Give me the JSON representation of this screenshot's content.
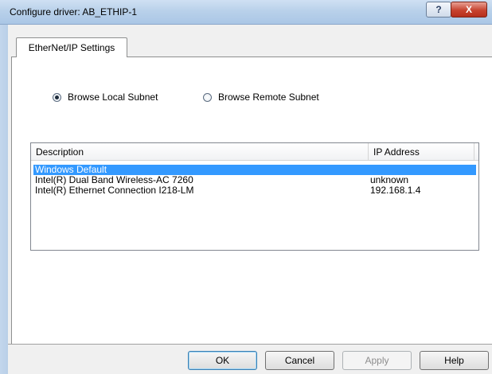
{
  "window": {
    "title": "Configure driver: AB_ETHIP-1",
    "help_glyph": "?",
    "close_glyph": "X"
  },
  "tab": {
    "label": "EtherNet/IP Settings"
  },
  "browse_options": [
    {
      "label": "Browse Local Subnet",
      "selected": true
    },
    {
      "label": "Browse Remote Subnet",
      "selected": false
    }
  ],
  "listview": {
    "columns": [
      "Description",
      "IP Address"
    ],
    "rows": [
      {
        "description": "Windows Default",
        "ip": "",
        "selected": true
      },
      {
        "description": "Intel(R) Dual Band Wireless-AC 7260",
        "ip": "unknown",
        "selected": false
      },
      {
        "description": "Intel(R) Ethernet Connection I218-LM",
        "ip": "192.168.1.4",
        "selected": false
      }
    ]
  },
  "buttons": {
    "ok": "OK",
    "cancel": "Cancel",
    "apply": "Apply",
    "help": "Help"
  }
}
